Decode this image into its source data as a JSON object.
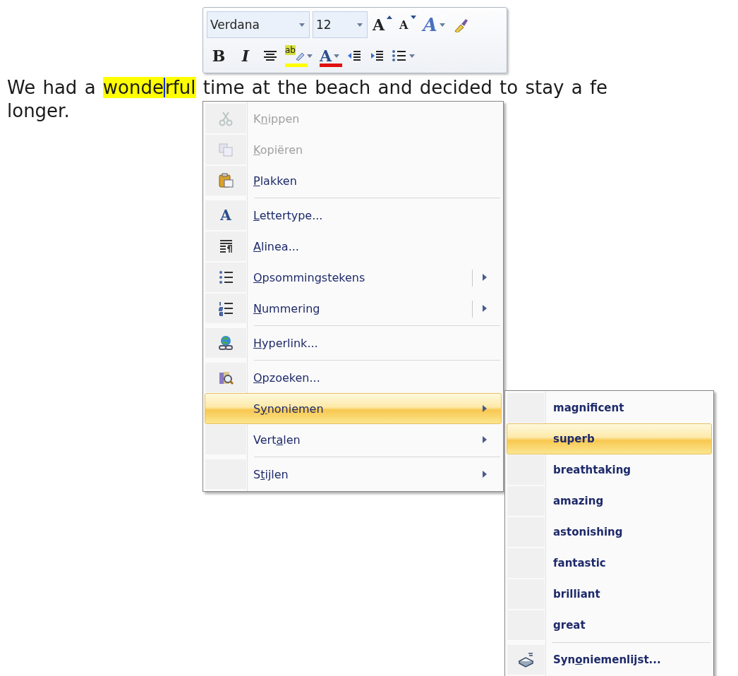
{
  "mini_toolbar": {
    "font_row": {
      "items": [
        {
          "kind": "combo",
          "value": "Verdana",
          "dropdown": true
        },
        {
          "kind": "combo",
          "value": "12",
          "dropdown": true
        },
        {
          "kind": "grow",
          "text": "A",
          "dropdown": false
        },
        {
          "kind": "shrink",
          "text": "A",
          "dropdown": false
        },
        {
          "kind": "styles",
          "text": "A",
          "dropdown": true
        },
        {
          "kind": "painter",
          "dropdown": false
        }
      ]
    },
    "format_row": {
      "items": [
        {
          "kind": "bold",
          "text": "B",
          "dropdown": false
        },
        {
          "kind": "italic",
          "text": "I",
          "dropdown": false
        },
        {
          "kind": "center",
          "dropdown": false
        },
        {
          "kind": "highlight",
          "text": "ab",
          "color": "#ffff00",
          "dropdown": true
        },
        {
          "kind": "fontcolor",
          "text": "A",
          "color": "#e01010",
          "dropdown": true
        },
        {
          "kind": "outdent",
          "dropdown": false
        },
        {
          "kind": "indent",
          "dropdown": false
        },
        {
          "kind": "bullets",
          "dropdown": true
        }
      ]
    }
  },
  "document": {
    "lines": [
      {
        "segments": [
          {
            "text": "We had a ",
            "highlight": false,
            "caret_after": false
          },
          {
            "text": "wonde",
            "highlight": true,
            "caret_after": true
          },
          {
            "text": "rful",
            "highlight": true,
            "caret_after": false
          },
          {
            "text": " time at the beach and decided to stay a fe",
            "highlight": false,
            "caret_after": false
          }
        ]
      },
      {
        "segments": [
          {
            "text": "longer.",
            "highlight": false,
            "caret_after": false
          }
        ]
      }
    ]
  },
  "context_menu": {
    "items": [
      {
        "kind": "command",
        "before": "K",
        "underlined": "n",
        "after": "ippen",
        "disabled": true,
        "selected": false,
        "submenu": false,
        "split": false
      },
      {
        "kind": "command",
        "underlined": "K",
        "after": "opiëren",
        "disabled": true,
        "selected": false,
        "submenu": false,
        "split": false
      },
      {
        "kind": "command",
        "underlined": "P",
        "after": "lakken",
        "disabled": false,
        "selected": false,
        "submenu": false,
        "split": false
      },
      {
        "kind": "separator"
      },
      {
        "kind": "command",
        "underlined": "L",
        "after": "ettertype...",
        "glyph": "A",
        "disabled": false,
        "selected": false,
        "submenu": false,
        "split": false
      },
      {
        "kind": "command",
        "underlined": "A",
        "after": "linea...",
        "disabled": false,
        "selected": false,
        "submenu": false,
        "split": false
      },
      {
        "kind": "command",
        "underlined": "O",
        "after": "psommingstekens",
        "disabled": false,
        "selected": false,
        "submenu": true,
        "split": true
      },
      {
        "kind": "command",
        "underlined": "N",
        "after": "ummering",
        "disabled": false,
        "selected": false,
        "submenu": true,
        "split": true
      },
      {
        "kind": "separator"
      },
      {
        "kind": "command",
        "underlined": "H",
        "after": "yperlink...",
        "disabled": false,
        "selected": false,
        "submenu": false,
        "split": false
      },
      {
        "kind": "separator"
      },
      {
        "kind": "command",
        "underlined": "O",
        "after": "pzoeken...",
        "disabled": false,
        "selected": false,
        "submenu": false,
        "split": false
      },
      {
        "kind": "command",
        "before": "S",
        "underlined": "y",
        "after": "noniemen",
        "disabled": false,
        "selected": true,
        "submenu": true,
        "split": false
      },
      {
        "kind": "command",
        "before": "Vert",
        "underlined": "a",
        "after": "len",
        "disabled": false,
        "selected": false,
        "submenu": true,
        "split": false
      },
      {
        "kind": "separator"
      },
      {
        "kind": "command",
        "before": "S",
        "underlined": "t",
        "after": "ijlen",
        "disabled": false,
        "selected": false,
        "submenu": true,
        "split": false
      }
    ]
  },
  "synonyms_menu": {
    "items": [
      {
        "kind": "command",
        "before": "magnificent",
        "selected": false
      },
      {
        "kind": "command",
        "before": "superb",
        "selected": true
      },
      {
        "kind": "command",
        "before": "breathtaking",
        "selected": false
      },
      {
        "kind": "command",
        "before": "amazing",
        "selected": false
      },
      {
        "kind": "command",
        "before": "astonishing",
        "selected": false
      },
      {
        "kind": "command",
        "before": "fantastic",
        "selected": false
      },
      {
        "kind": "command",
        "before": "brilliant",
        "selected": false
      },
      {
        "kind": "command",
        "before": "great",
        "selected": false
      },
      {
        "kind": "separator"
      },
      {
        "kind": "command",
        "before": "Syn",
        "underlined": "o",
        "after": "niemenlijst...",
        "selected": false
      }
    ]
  }
}
